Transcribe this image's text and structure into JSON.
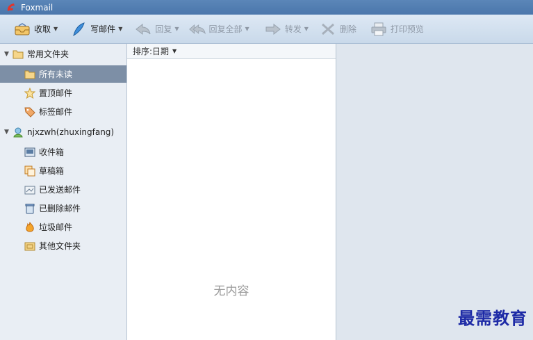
{
  "window": {
    "title": "Foxmail"
  },
  "toolbar": {
    "receive": "收取",
    "compose": "写邮件",
    "reply": "回复",
    "reply_all": "回复全部",
    "forward": "转发",
    "delete": "删除",
    "print_preview": "打印预览"
  },
  "sidebar": {
    "common_folders": "常用文件夹",
    "all_unread": "所有未读",
    "pinned": "置顶邮件",
    "tagged": "标签邮件",
    "account": "njxzwh(zhuxingfang)",
    "inbox": "收件箱",
    "drafts": "草稿箱",
    "sent": "已发送邮件",
    "deleted": "已删除邮件",
    "junk": "垃圾邮件",
    "other": "其他文件夹"
  },
  "list": {
    "sort_label": "排序:日期",
    "empty_text": "无内容"
  },
  "watermark": "最需教育",
  "colors": {
    "titlebar": "#4a76ab",
    "selected_row": "#7d8fa6",
    "watermark": "#1d2aa6"
  }
}
